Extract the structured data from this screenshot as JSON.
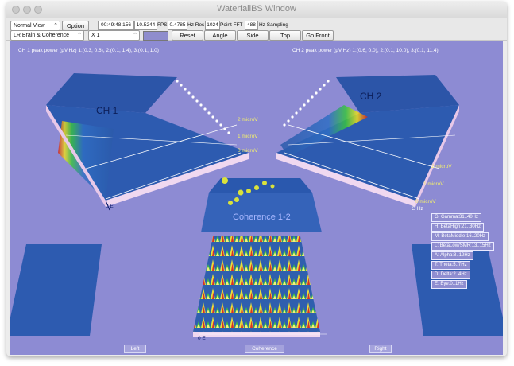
{
  "window": {
    "title": "WaterfallBS Window"
  },
  "toolbar": {
    "view_mode": "Normal View",
    "option_label": "Option",
    "montage": "LR Brain & Coherence",
    "zoom": "X 1",
    "time": "00:49:48.156",
    "fps_value": "10.5244",
    "fps_label": "FPS",
    "hz_res_value": "0.4785",
    "hz_res_label": "Hz Res",
    "fft_points": "1024",
    "fft_label": "Point FFT",
    "sampling_value": "488",
    "sampling_label": "Hz Sampling",
    "reset_label": "Reset",
    "angle_label": "Angle",
    "side_label": "Side",
    "top_label": "Top",
    "front_label": "Go Front",
    "swatch_color": "#8f8dcd"
  },
  "view": {
    "ch1_header": "CH 1 peak power (µV,Hz) 1:(0.3, 0.6), 2:(0.1, 1.4), 3:(0.1, 1.0)",
    "ch2_header": "CH 2 peak power (µV,Hz) 1:(0.6, 0.0), 2:(0.1, 10.0), 3:(0.1, 11.4)",
    "ch1_label": "CH 1",
    "ch2_label": "CH 2",
    "coherence_label": "Coherence 1-2",
    "ch1_scale": [
      "2 microV",
      "1 microV",
      "0 microV"
    ],
    "ch2_scale": [
      "2 microV",
      "1 microV",
      "0 microV"
    ],
    "ch1_axis": "0 E",
    "ch2_axis": "G  Hz",
    "coh_axis": "0 E",
    "background_color": "#8d8bd3",
    "legend": [
      "G: Gamma:31..40Hz",
      "H: BetaHigh:21..30Hz",
      "M: BetaMiddle:16..20Hz",
      "L: BetaLow/SMR:13..15Hz",
      "A: Alpha:8..12Hz",
      "T: Theta:5..7Hz",
      "D: Delta:2..4Hz",
      "E: Eye:0..1Hz"
    ],
    "bottom_labels": {
      "left": "Left",
      "coherence": "Coherence",
      "right": "Right"
    }
  }
}
